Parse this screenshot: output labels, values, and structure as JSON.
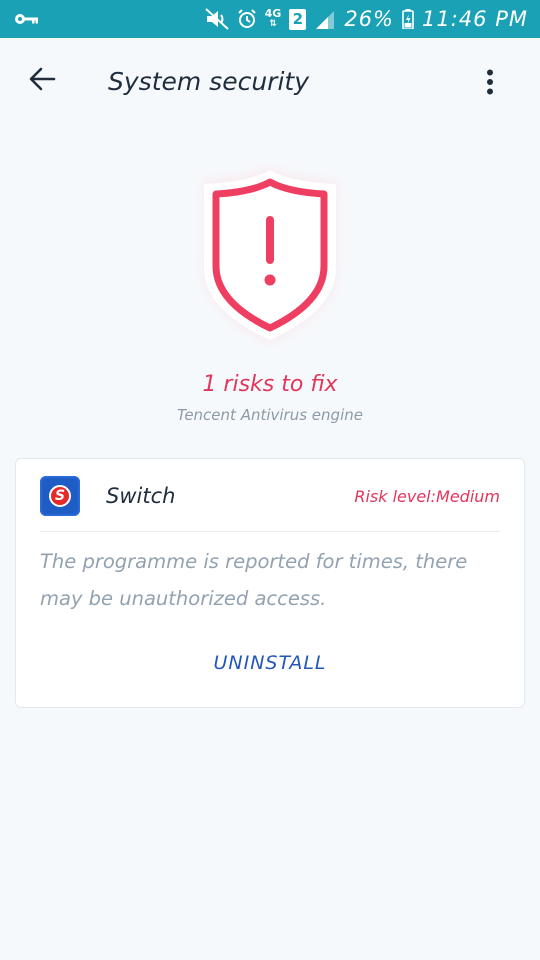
{
  "status_bar": {
    "battery": "26%",
    "time": "11:46 PM",
    "network": "4G",
    "sim_slot": "2",
    "icons": [
      "key-icon",
      "mute-icon",
      "alarm-icon",
      "signal-icon",
      "battery-icon"
    ],
    "background_color": "#1aa1b5"
  },
  "app_bar": {
    "title": "System security",
    "icons": [
      "back-arrow-icon",
      "more-vert-icon"
    ]
  },
  "summary": {
    "risk_text": "1 risks to fix",
    "engine": "Tencent Antivirus engine",
    "shield_icon": "warning-shield-icon",
    "accent_color": "#e2355b"
  },
  "risk_card": {
    "app_name": "Switch",
    "app_icon": "switch-app-icon",
    "app_icon_letter": "S",
    "risk_level": "Risk level:Medium",
    "description": "The programme is reported for times, there may be unauthorized access.",
    "action_label": "UNINSTALL",
    "action_color": "#2557b8"
  }
}
